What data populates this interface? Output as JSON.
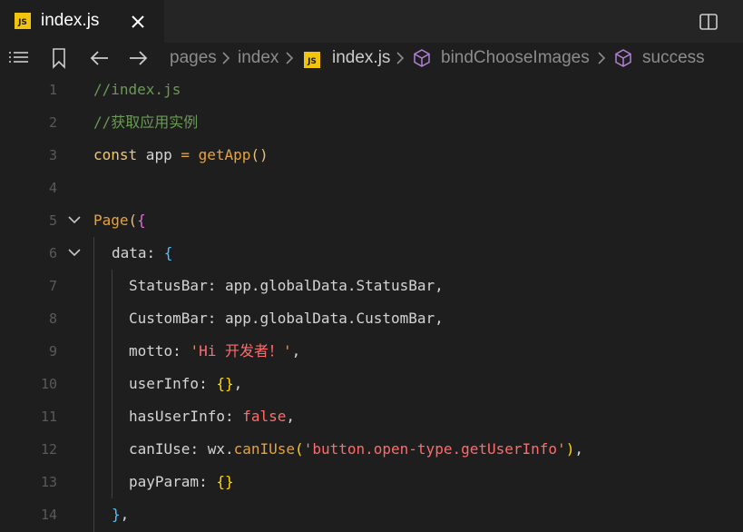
{
  "tab": {
    "badge": "JS",
    "title": "index.js"
  },
  "breadcrumb": {
    "items": [
      "pages",
      "index",
      "index.js",
      "bindChooseImages",
      "success"
    ],
    "file_badge": "JS"
  },
  "icons": {
    "tab_file": "js-file-icon",
    "close": "close-icon",
    "split": "split-editor-icon",
    "outline": "list-icon",
    "bookmark": "bookmark-icon",
    "back": "arrow-left-icon",
    "forward": "arrow-right-icon",
    "symbol": "cube-icon"
  },
  "colors": {
    "background": "#1e1e1e",
    "tabbar": "#252526",
    "js_badge": "#f1c40f",
    "comment": "#6a9955",
    "keyword": "#f0c674",
    "string": "#ff6b6b"
  },
  "editor": {
    "line_numbers": [
      "1",
      "2",
      "3",
      "4",
      "5",
      "6",
      "7",
      "8",
      "9",
      "10",
      "11",
      "12",
      "13",
      "14"
    ],
    "lines": {
      "l1": {
        "comment": "//index.js"
      },
      "l2": {
        "comment": "//获取应用实例"
      },
      "l3": {
        "kw": "const",
        "name": " app ",
        "op": "=",
        "fn": " getApp",
        "paren": "()"
      },
      "l5": {
        "fn": "Page",
        "paren": "(",
        "brace": "{"
      },
      "l6": {
        "key": "data",
        "colon": ": ",
        "brace": "{"
      },
      "l7": {
        "key": "StatusBar",
        "rest": ": app.globalData.StatusBar,"
      },
      "l8": {
        "key": "CustomBar",
        "rest": ": app.globalData.CustomBar,"
      },
      "l9": {
        "key": "motto",
        "colon": ": ",
        "q1": "'",
        "str": "Hi 开发者！",
        "q2": "'",
        "comma": ","
      },
      "l10": {
        "key": "userInfo",
        "colon": ": ",
        "braces": "{}",
        "comma": ","
      },
      "l11": {
        "key": "hasUserInfo",
        "colon": ": ",
        "bool": "false",
        "comma": ","
      },
      "l12": {
        "key": "canIUse",
        "colon": ": ",
        "obj": "wx.",
        "fn": "canIUse",
        "p1": "(",
        "q1": "'",
        "str": "button.open-type.getUserInfo",
        "q2": "'",
        "p2": ")",
        "comma": ","
      },
      "l13": {
        "key": "payParam",
        "colon": ": ",
        "braces": "{}"
      },
      "l14": {
        "brace": "}",
        "comma": ","
      }
    }
  }
}
